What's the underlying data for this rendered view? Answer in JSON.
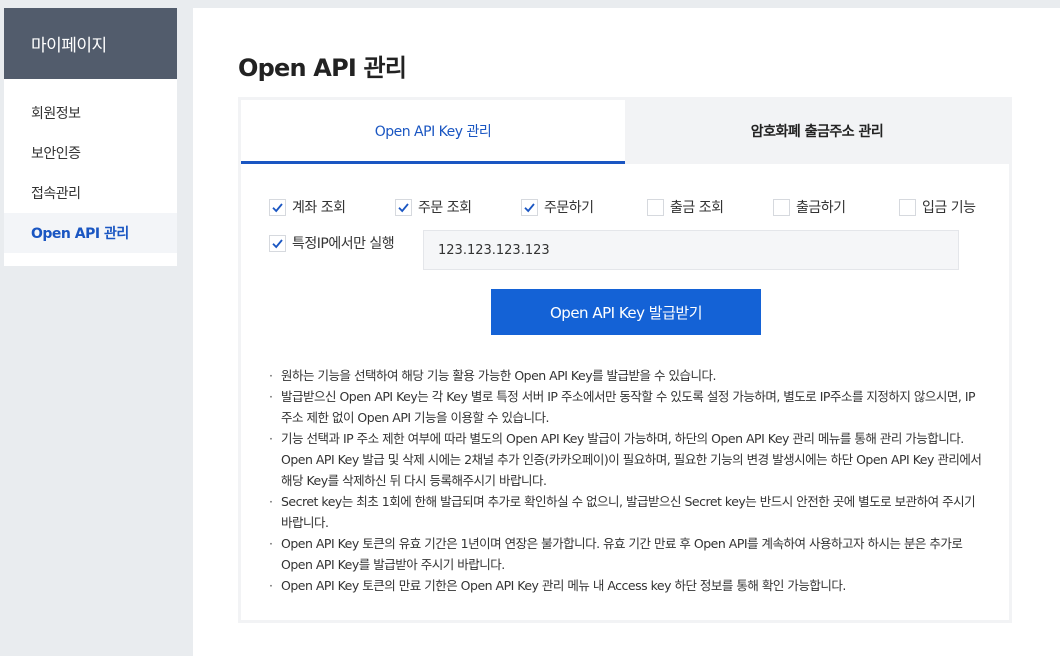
{
  "sidebar": {
    "title": "마이페이지",
    "items": [
      {
        "label": "회원정보"
      },
      {
        "label": "보안인증"
      },
      {
        "label": "접속관리"
      },
      {
        "label": "Open API 관리"
      }
    ]
  },
  "main": {
    "title": "Open API 관리",
    "tabs": [
      {
        "label": "Open API Key 관리"
      },
      {
        "label": "암호화폐 출금주소 관리"
      }
    ],
    "permissions": [
      {
        "label": "계좌 조회",
        "checked": true
      },
      {
        "label": "주문 조회",
        "checked": true
      },
      {
        "label": "주문하기",
        "checked": true
      },
      {
        "label": "출금 조회",
        "checked": false
      },
      {
        "label": "출금하기",
        "checked": false
      },
      {
        "label": "입금 기능",
        "checked": false
      }
    ],
    "ip_restriction": {
      "label": "특정IP에서만 실행",
      "checked": true,
      "value": "123.123.123.123"
    },
    "issue_button_label": "Open API Key 발급받기",
    "notes": [
      "원하는 기능을 선택하여 해당 기능 활용 가능한 Open API Key를 발급받을 수 있습니다.",
      "발급받으신 Open API Key는 각 Key 별로 특정 서버 IP 주소에서만 동작할 수 있도록 설정 가능하며, 별도로 IP주소를 지정하지 않으시면, IP 주소 제한 없이 Open API 기능을 이용할 수 있습니다.",
      "기능 선택과 IP 주소 제한 여부에 따라 별도의 Open API Key 발급이 가능하며, 하단의 Open API Key 관리 메뉴를 통해 관리 가능합니다. Open API Key 발급 및 삭제 시에는 2채널 추가 인증(카카오페이)이 필요하며, 필요한 기능의 변경 발생시에는 하단 Open API Key 관리에서 해당 Key를 삭제하신 뒤 다시 등록해주시기 바랍니다.",
      "Secret key는 최초 1회에 한해 발급되며 추가로 확인하실 수 없으니, 발급받으신 Secret key는 반드시 안전한 곳에 별도로 보관하여 주시기 바랍니다.",
      "Open API Key 토큰의 유효 기간은 1년이며 연장은 불가합니다. 유효 기간 만료 후 Open API를 계속하여 사용하고자 하시는 분은 추가로 Open API Key를 발급받아 주시기 바랍니다.",
      "Open API Key 토큰의 만료 기한은 Open API Key 관리 메뉴 내 Access key 하단 정보를 통해 확인 가능합니다."
    ]
  },
  "colors": {
    "accent": "#1462d6",
    "sidebar_head": "#525c6c"
  }
}
